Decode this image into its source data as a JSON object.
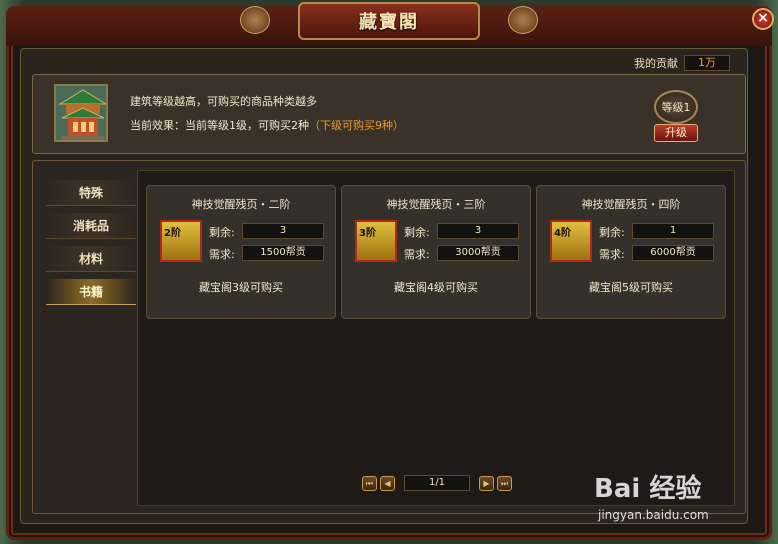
{
  "window": {
    "title": "藏寶閣",
    "close_label": "×"
  },
  "contribution": {
    "label": "我的贡献",
    "value": "1万"
  },
  "info": {
    "line1": "建筑等级越高，可购买的商品种类越多",
    "line2_main": "当前效果：当前等级1级，可购买2种",
    "line2_highlight": "（下级可购买9种）",
    "level_label": "等级1",
    "upgrade_label": "升级"
  },
  "tabs": [
    {
      "label": "特殊",
      "active": false
    },
    {
      "label": "消耗品",
      "active": false
    },
    {
      "label": "材料",
      "active": false
    },
    {
      "label": "书籍",
      "active": true
    }
  ],
  "items": [
    {
      "title": "神技觉醒残页・二阶",
      "tier": "2阶",
      "remaining_label": "剩余:",
      "remaining": "3",
      "cost_label": "需求:",
      "cost": "1500帮贡",
      "note": "藏宝阁3级可购买"
    },
    {
      "title": "神技觉醒残页・三阶",
      "tier": "3阶",
      "remaining_label": "剩余:",
      "remaining": "3",
      "cost_label": "需求:",
      "cost": "3000帮贡",
      "note": "藏宝阁4级可购买"
    },
    {
      "title": "神技觉醒残页・四阶",
      "tier": "4阶",
      "remaining_label": "剩余:",
      "remaining": "1",
      "cost_label": "需求:",
      "cost": "6000帮贡",
      "note": "藏宝阁5级可购买"
    }
  ],
  "pager": {
    "display": "1/1",
    "first": "⏮",
    "prev": "◀",
    "next": "▶",
    "last": "⏭"
  },
  "watermark": {
    "logo": "Bai 经验",
    "url": "jingyan.baidu.com"
  }
}
